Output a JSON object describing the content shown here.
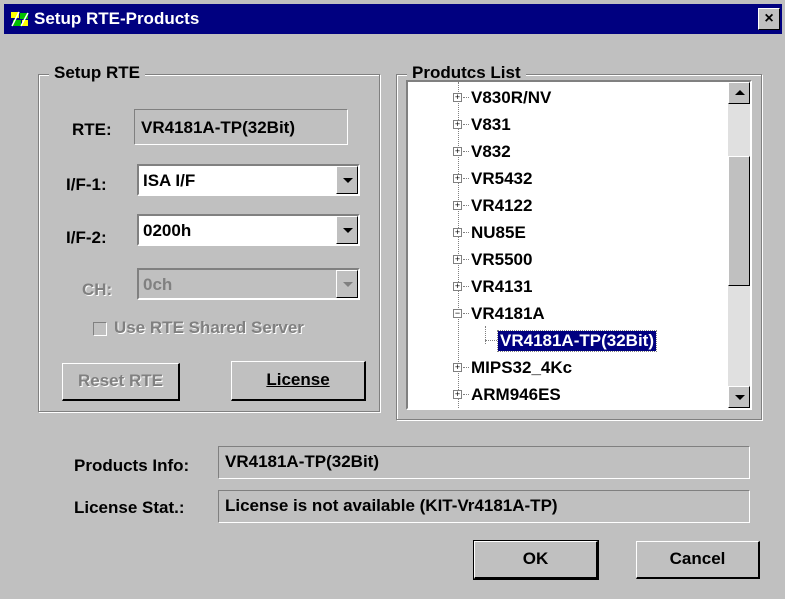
{
  "window": {
    "title": "Setup RTE-Products",
    "close_label": "×"
  },
  "setup_rte": {
    "legend": "Setup RTE",
    "rte_label": "RTE:",
    "rte_value": "VR4181A-TP(32Bit)",
    "if1_label": "I/F-1:",
    "if1_value": "ISA I/F",
    "if2_label": "I/F-2:",
    "if2_value": "0200h",
    "ch_label": "CH:",
    "ch_value": "0ch",
    "shared_server_label": "Use RTE Shared Server",
    "reset_label": "Reset RTE",
    "license_label": "License"
  },
  "products_list": {
    "legend": "Produtcs List",
    "items": [
      {
        "label": "V830R/NV",
        "expander": "+"
      },
      {
        "label": "V831",
        "expander": "+"
      },
      {
        "label": "V832",
        "expander": "+"
      },
      {
        "label": "VR5432",
        "expander": "+"
      },
      {
        "label": "VR4122",
        "expander": "+"
      },
      {
        "label": "NU85E",
        "expander": "+"
      },
      {
        "label": "VR5500",
        "expander": "+"
      },
      {
        "label": "VR4131",
        "expander": "+"
      },
      {
        "label": "VR4181A",
        "expander": "−"
      },
      {
        "label": "VR4181A-TP(32Bit)",
        "expander": ""
      },
      {
        "label": "MIPS32_4Kc",
        "expander": "+"
      },
      {
        "label": "ARM946ES",
        "expander": "+"
      }
    ],
    "selected": "VR4181A-TP(32Bit)"
  },
  "info": {
    "products_info_label": "Products Info:",
    "products_info_value": "VR4181A-TP(32Bit)",
    "license_stat_label": "License Stat.:",
    "license_stat_value": "License is not available (KIT-Vr4181A-TP)"
  },
  "buttons": {
    "ok": "OK",
    "cancel": "Cancel"
  }
}
